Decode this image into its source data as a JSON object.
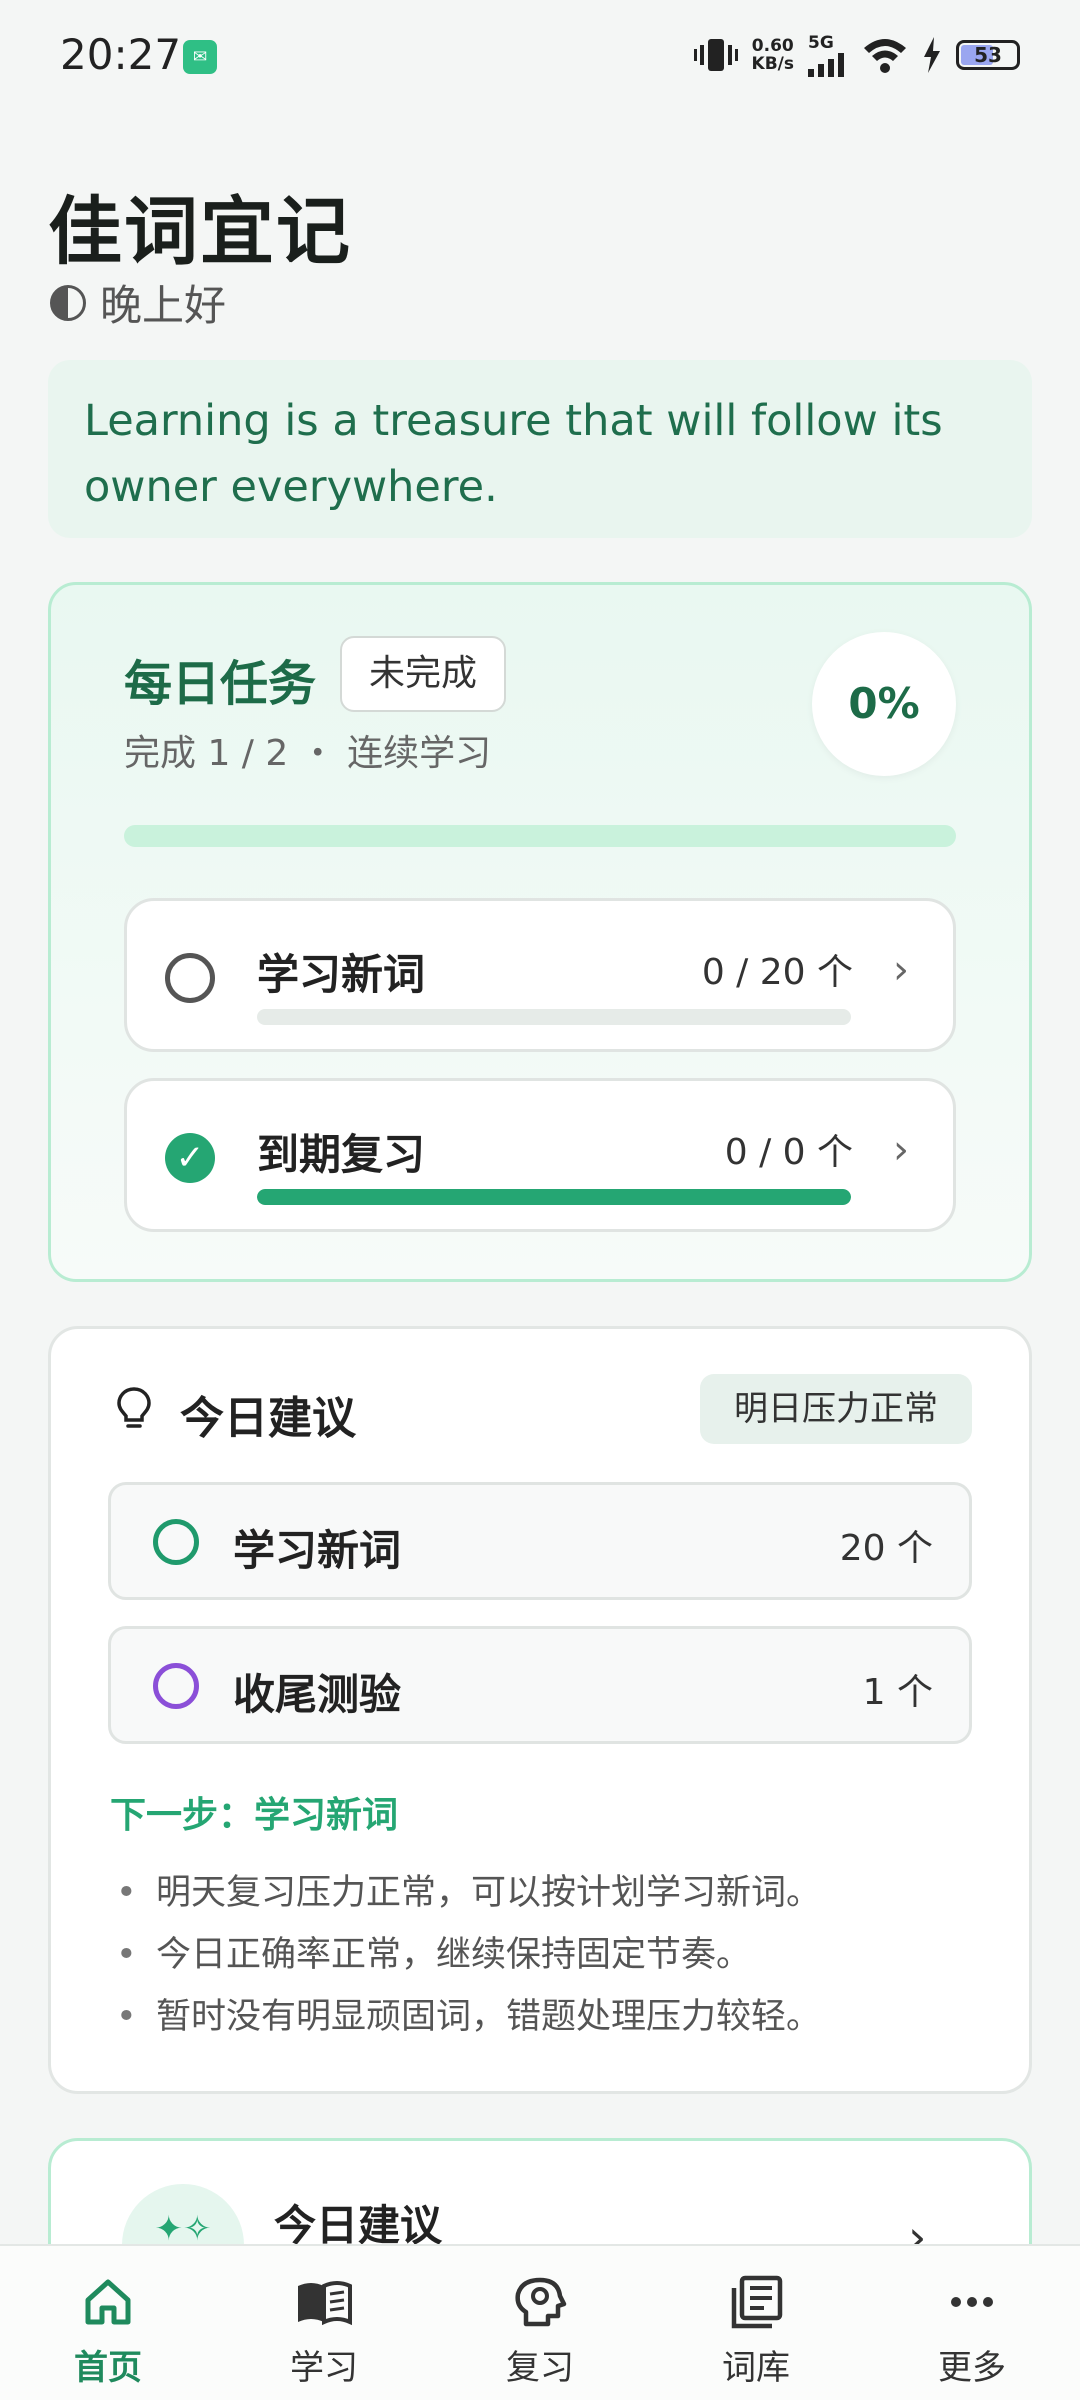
{
  "status_bar": {
    "time": "20:27",
    "speed_value": "0.60",
    "speed_unit": "KB/s",
    "network": "5G",
    "battery": "53"
  },
  "header": {
    "title": "佳词宜记",
    "greeting": "晚上好"
  },
  "quote": {
    "text": "Learning is a treasure that will follow its owner everywhere."
  },
  "daily_task": {
    "title": "每日任务",
    "badge": "未完成",
    "subtitle": "完成 1 / 2 ・ 连续学习",
    "percent": "0%",
    "progress": 0.0,
    "items": [
      {
        "label": "学习新词",
        "count": "0 / 20 个",
        "done": false,
        "progress": 0.0
      },
      {
        "label": "到期复习",
        "count": "0 / 0 个",
        "done": true,
        "progress": 1.0
      }
    ]
  },
  "suggestions": {
    "title": "今日建议",
    "badge": "明日压力正常",
    "rows": [
      {
        "label": "学习新词",
        "count": "20 个",
        "color": "#1f9a6c"
      },
      {
        "label": "收尾测验",
        "count": "1 个",
        "color": "#8b4fd8"
      }
    ],
    "next_step": "下一步：学习新词",
    "tips": [
      "明天复习压力正常，可以按计划学习新词。",
      "今日正确率正常，继续保持固定节奏。",
      "暂时没有明显顽固词，错题处理压力较轻。"
    ]
  },
  "teaser": {
    "title": "今日建议"
  },
  "nav": {
    "items": [
      {
        "label": "首页",
        "icon": "home-icon",
        "active": true
      },
      {
        "label": "学习",
        "icon": "book-icon",
        "active": false
      },
      {
        "label": "复习",
        "icon": "brain-icon",
        "active": false
      },
      {
        "label": "词库",
        "icon": "library-icon",
        "active": false
      },
      {
        "label": "更多",
        "icon": "more-icon",
        "active": false
      }
    ]
  },
  "colors": {
    "accent": "#25a673",
    "accent_dark": "#1d6b48",
    "nav_active": "#1f8a5d"
  }
}
